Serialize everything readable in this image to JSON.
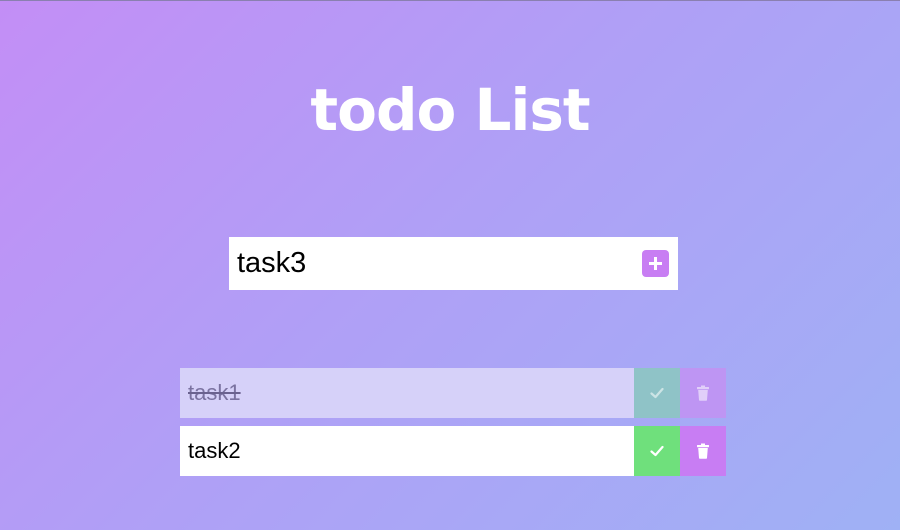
{
  "app": {
    "title": "todo List"
  },
  "new_task": {
    "value": "task3",
    "add_icon": "plus-icon"
  },
  "todos": [
    {
      "text": "task1",
      "completed": true
    },
    {
      "text": "task2",
      "completed": false
    }
  ],
  "icons": {
    "complete": "check-icon",
    "delete": "trash-icon"
  },
  "colors": {
    "accent": "#c87df3",
    "complete_button": "#6fe07c",
    "completed_row": "#d6d1f9",
    "background_start": "#c38ef6",
    "background_end": "#9fb1f5"
  }
}
